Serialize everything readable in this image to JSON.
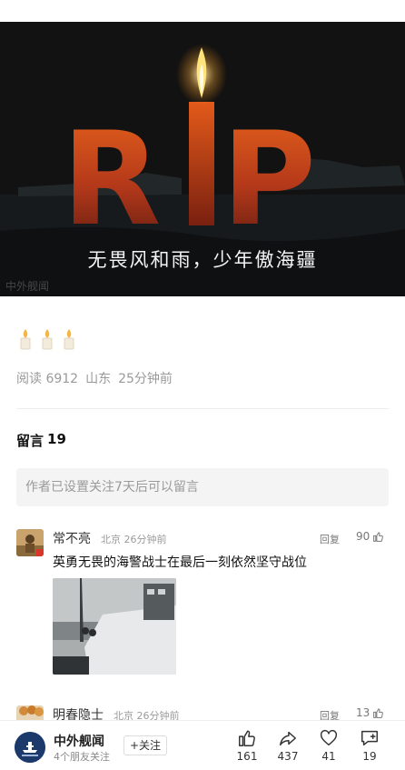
{
  "hero": {
    "title_letters": [
      "R",
      "P"
    ],
    "caption": "无畏风和雨，少年傲海疆",
    "watermark": "中外舰闻"
  },
  "candle_icons": [
    "candle-icon",
    "candle-icon",
    "candle-icon"
  ],
  "meta": {
    "reads": "阅读 6912",
    "location": "山东",
    "time": "25分钟前"
  },
  "comments_section": {
    "title": "留言",
    "count": "19",
    "notice": "作者已设置关注7天后可以留言"
  },
  "comments": [
    {
      "name": "常不亮",
      "location": "北京",
      "time": "26分钟前",
      "reply_label": "回复",
      "likes": "90",
      "text": "英勇无畏的海警战士在最后一刻依然坚守战位"
    },
    {
      "name": "明春隐士",
      "location": "北京",
      "time": "26分钟前",
      "reply_label": "回复",
      "likes": "13"
    }
  ],
  "bottom_bar": {
    "account_name": "中外舰闻",
    "friends_following": "4个朋友关注",
    "follow_label": "+关注",
    "like_count": "161",
    "share_count": "437",
    "heart_count": "41",
    "comment_count": "19"
  },
  "colors": {
    "hero_bg": "#111111",
    "rip_orange": "#d8551e",
    "flame": "#ffd24a",
    "text_gray": "#9a9a9a",
    "logo_blue": "#1b3a6b"
  }
}
